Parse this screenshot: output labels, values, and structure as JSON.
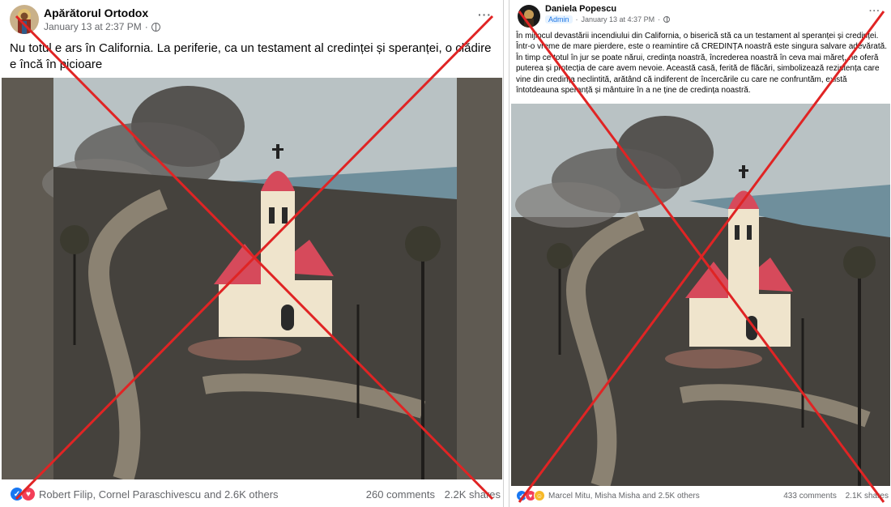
{
  "left_post": {
    "author": "Apărătorul Ortodox",
    "timestamp": "January 13 at 2:37 PM",
    "separator": "·",
    "privacy_icon": "globe-icon",
    "more_label": "···",
    "text": "Nu totul e ars în California. La periferie, ca un testament al credinței și speranței, o clădire e încă în picioare",
    "reactions_text": "Robert Filip, Cornel Paraschivescu and 2.6K others",
    "comments": "260 comments",
    "shares": "2.2K shares",
    "reaction_icons": [
      "like-icon",
      "love-icon"
    ]
  },
  "right_post": {
    "author": "Daniela Popescu",
    "role_badge": "Admin",
    "timestamp": "January 13 at 4:37 PM",
    "separator": "·",
    "privacy_icon": "globe-icon",
    "more_label": "···",
    "text": "În mijlocul devastării incendiului din California, o biserică stă ca un testament al speranței și credinței. Într-o vreme de mare pierdere, este o reamintire că CREDINȚA noastră este singura salvare adevărată. În timp ce totul în jur se poate nărui, credința noastră, încrederea noastră în ceva mai măreț, ne oferă puterea și protecția de care avem nevoie. Această casă, ferită de flăcări, simbolizează rezistența care vine din credința neclintită, arătând că indiferent de încercările cu care ne confruntăm, există întotdeauna speranță și mântuire în a ne ține de credința noastră.",
    "reactions_text": "Marcel Mitu, Misha Misha and 2.5K others",
    "comments": "433 comments",
    "shares": "2.1K shares",
    "reaction_icons": [
      "like-icon",
      "love-icon",
      "care-icon"
    ]
  },
  "overlay": {
    "cross_color": "#e02424",
    "meaning": "red X marks over both posts"
  },
  "colors": {
    "text": "#050505",
    "muted": "#65676b",
    "like": "#1877f2",
    "love": "#f33e58",
    "care": "#f7b928"
  }
}
